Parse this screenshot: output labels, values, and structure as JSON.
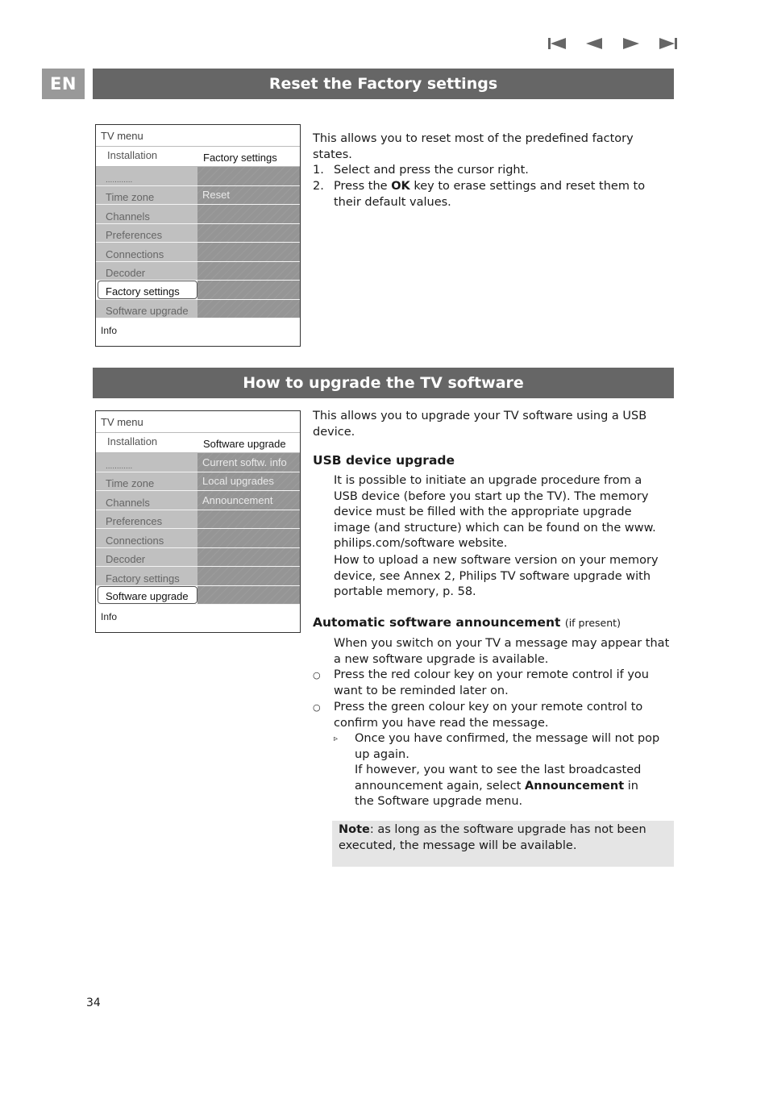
{
  "nav": {
    "buttons": [
      {
        "name": "first-page-icon",
        "label": "First"
      },
      {
        "name": "previous-page-icon",
        "label": "Previous"
      },
      {
        "name": "next-page-icon",
        "label": "Next"
      },
      {
        "name": "last-page-icon",
        "label": "Last"
      }
    ]
  },
  "language_tag": "EN",
  "section1": {
    "title": "Reset the Factory settings",
    "tv_menu": {
      "title": "TV menu",
      "sub_left": "Installation",
      "sub_right": "Factory settings",
      "rows": [
        {
          "left": "............",
          "right": ""
        },
        {
          "left": "Time zone",
          "right": "Reset"
        },
        {
          "left": "Channels",
          "right": ""
        },
        {
          "left": "Preferences",
          "right": ""
        },
        {
          "left": "Connections",
          "right": ""
        },
        {
          "left": "Decoder",
          "right": ""
        },
        {
          "left": "Factory settings",
          "right": "",
          "selected": true
        },
        {
          "left": "Software upgrade",
          "right": ""
        }
      ],
      "info": "Info"
    },
    "intro": "This allows you to reset most of the predefined factory states.",
    "steps": [
      {
        "num": "1.",
        "text": "Select and press the cursor right."
      },
      {
        "num": "2.",
        "pre": "Press the ",
        "bold": "OK",
        "post": " key to erase settings and reset them to their default values."
      }
    ]
  },
  "section2": {
    "title": "How to upgrade the TV software",
    "tv_menu": {
      "title": "TV menu",
      "sub_left": "Installation",
      "sub_right": "Software upgrade",
      "rows": [
        {
          "left": "............",
          "right": "Current softw. info"
        },
        {
          "left": "Time zone",
          "right": "Local upgrades"
        },
        {
          "left": "Channels",
          "right": "Announcement"
        },
        {
          "left": "Preferences",
          "right": ""
        },
        {
          "left": "Connections",
          "right": ""
        },
        {
          "left": "Decoder",
          "right": ""
        },
        {
          "left": "Factory settings",
          "right": ""
        },
        {
          "left": "Software upgrade",
          "right": "",
          "selected": true
        }
      ],
      "info": "Info"
    },
    "intro": "This allows you to upgrade your TV software using a USB device.",
    "usb_heading": "USB device upgrade",
    "usb_para1": "It is possible to initiate an upgrade procedure from a USB device (before you start up the TV). The memory device must be filled with the appropriate upgrade image (and structure) which can be found on the www. philips.com/software website.",
    "usb_para2": "How to upload a new software version on your memory device, see Annex 2, Philips TV software upgrade with portable memory, p. 58.",
    "auto_heading": "Automatic software announcement",
    "auto_heading_note": "(if present)",
    "auto_para": "When you switch on your TV a message may appear that a new software upgrade is available.",
    "bullets": [
      "Press the red colour key on your remote control if you want to be reminded later on.",
      "Press the green colour key on your remote control to confirm you have read the message."
    ],
    "sub_bullet": "Once you have confirmed, the message will not pop up again.",
    "sub_para_pre": "If however, you want to see the last broadcasted announcement again, select ",
    "sub_para_bold": "Announcement",
    "sub_para_post": " in the Software upgrade menu.",
    "note_bold": "Note",
    "note_text": ": as long as the software upgrade has not been executed, the message will be available."
  },
  "page_number": "34"
}
